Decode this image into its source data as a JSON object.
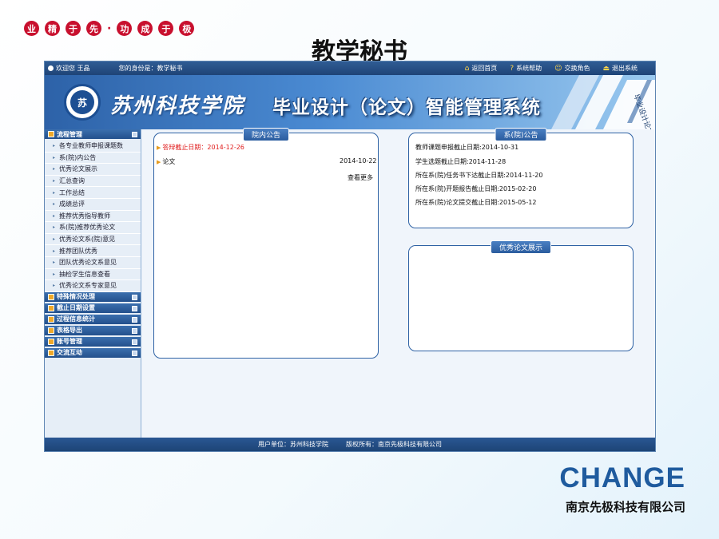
{
  "slogan": {
    "chars": [
      "业",
      "精",
      "于",
      "先",
      "功",
      "成",
      "于",
      "极"
    ],
    "separator": "·",
    "color": "#c8102e"
  },
  "slide_title": "教学秘书",
  "topbar": {
    "welcome": "欢迎您 王晶",
    "identity": "您的身份是：教学秘书",
    "nav": [
      {
        "label": "返回首页",
        "icon": "home-icon"
      },
      {
        "label": "系统帮助",
        "icon": "help-icon"
      },
      {
        "label": "交换角色",
        "icon": "switch-role-icon"
      },
      {
        "label": "退出系统",
        "icon": "logout-icon"
      }
    ]
  },
  "banner": {
    "school_name": "苏州科技学院",
    "system_title": "毕业设计（论文）智能管理系统",
    "book_text": "毕业设计论文"
  },
  "sidebar": {
    "sections": [
      {
        "title": "流程管理",
        "expanded": true,
        "items": [
          "各专业教师申报课题数",
          "系(院)内公告",
          "优秀论文展示",
          "汇总查询",
          "工作总结",
          "成绩总评",
          "推荐优秀指导教师",
          "系(院)推荐优秀论文",
          "优秀论文系(院)意见",
          "推荐团队优秀",
          "团队优秀论文系意见",
          "抽检学生信息查看",
          "优秀论文系专家意见"
        ]
      },
      {
        "title": "特殊情况处理"
      },
      {
        "title": "截止日期设置"
      },
      {
        "title": "过程信息统计"
      },
      {
        "title": "表格导出"
      },
      {
        "title": "账号管理"
      },
      {
        "title": "交流互动"
      }
    ]
  },
  "college_notice": {
    "title": "院内公告",
    "items": [
      {
        "text": "答辩截止日期：2014-12-26",
        "date": "",
        "highlight": true
      },
      {
        "text": "论文",
        "date": "2014-10-22",
        "highlight": false
      }
    ],
    "more": "查看更多"
  },
  "dept_notice": {
    "title": "系(院)公告",
    "items": [
      "教师课题申报截止日期:2014-10-31",
      "学生选题截止日期:2014-11-28",
      "所在系(院)任务书下达截止日期:2014-11-20",
      "所在系(院)开题报告截止日期:2015-02-20",
      "所在系(院)论文提交截止日期:2015-05-12"
    ]
  },
  "excellent_papers": {
    "title": "优秀论文展示"
  },
  "footer": {
    "unit": "用户单位：苏州科技学院",
    "copyright": "版权所有：南京先极科技有限公司"
  },
  "company": {
    "logo": "CHANGE",
    "name": "南京先极科技有限公司",
    "brand_color": "#1f5b9e"
  }
}
